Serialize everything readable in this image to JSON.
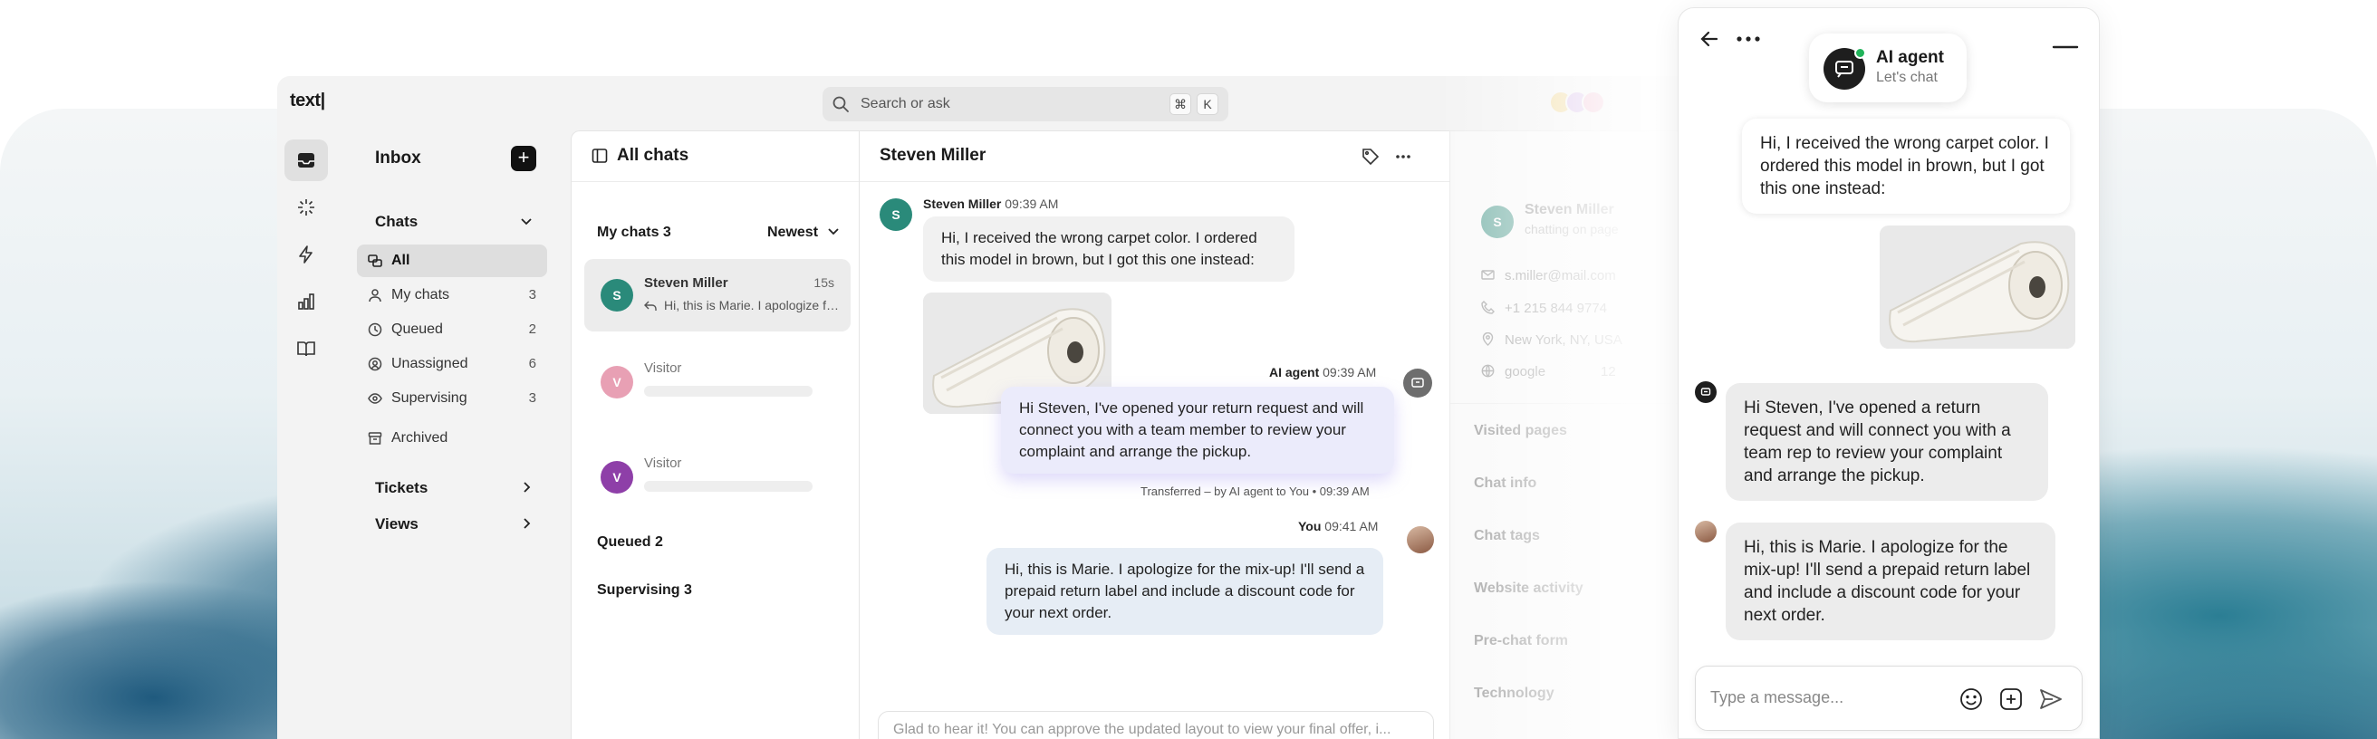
{
  "app": {
    "logo": "text|",
    "search": {
      "placeholder": "Search or ask",
      "shortcut_mod": "⌘",
      "shortcut_key": "K"
    }
  },
  "nav": {
    "title": "Inbox",
    "chats_label": "Chats",
    "items": [
      {
        "label": "All",
        "count": ""
      },
      {
        "label": "My chats",
        "count": "3"
      },
      {
        "label": "Queued",
        "count": "2"
      },
      {
        "label": "Unassigned",
        "count": "6"
      },
      {
        "label": "Supervising",
        "count": "3"
      }
    ],
    "archived": "Archived",
    "tickets": "Tickets",
    "views": "Views"
  },
  "chat_list": {
    "title": "All chats",
    "my_chats": "My chats 3",
    "sort": "Newest",
    "rows": [
      {
        "initial": "S",
        "name": "Steven Miller",
        "time": "15s",
        "preview": "Hi, this is Marie. I apologize for the mix-up!"
      },
      {
        "initial": "V",
        "name": "Visitor"
      },
      {
        "initial": "V",
        "name": "Visitor"
      }
    ],
    "queued": "Queued 2",
    "supervising": "Supervising 3"
  },
  "conversation": {
    "title": "Steven Miller",
    "visitor_initial": "S",
    "visitor_name": "Steven Miller",
    "visitor_time": "09:39 AM",
    "visitor_message": "Hi, I received the wrong carpet color. I ordered this model in brown, but I got this one instead:",
    "ai_name": "AI agent",
    "ai_time": "09:39 AM",
    "ai_message": "Hi Steven, I've opened your return request and will connect you with a team member to review your complaint and arrange the pickup.",
    "transfer_note": "Transferred – by AI agent to You • 09:39 AM",
    "me_name": "You",
    "me_time": "09:41 AM",
    "me_message": "Hi, this is Marie. I apologize for the mix-up! I'll send a prepaid return label and include a discount code for your next order.",
    "composer_text": "Glad to hear it! You can approve the updated layout to view your final offer, i..."
  },
  "details": {
    "initial": "S",
    "name": "Steven Miller",
    "status": "chatting on page",
    "email": "s.miller@mail.com",
    "phone": "+1 215 844 9774",
    "location": "New York, NY, USA",
    "source": "google",
    "visits": "12",
    "sections": [
      "Visited pages",
      "Chat info",
      "Chat tags",
      "Website activity",
      "Pre-chat form",
      "Technology"
    ]
  },
  "widget": {
    "agent_name": "AI agent",
    "agent_subtitle": "Let's chat",
    "visitor_message": "Hi, I received the wrong carpet color. I ordered this model in brown, but I got this one instead:",
    "ai_message": "Hi Steven, I've opened a return request and will connect you with a team rep to review your complaint and arrange the pickup.",
    "agent_message": "Hi, this is Marie. I apologize for the mix-up! I'll send a prepaid return label and include a discount code for your next order.",
    "input_placeholder": "Type a message..."
  },
  "colors": {
    "accent_ai": "#ebebfb",
    "status_online": "#21b35a",
    "avatar_steven": "#2a8a7a",
    "avatar_visitor_1": "#e8a0b4",
    "avatar_visitor_2": "#8e3fa8"
  }
}
